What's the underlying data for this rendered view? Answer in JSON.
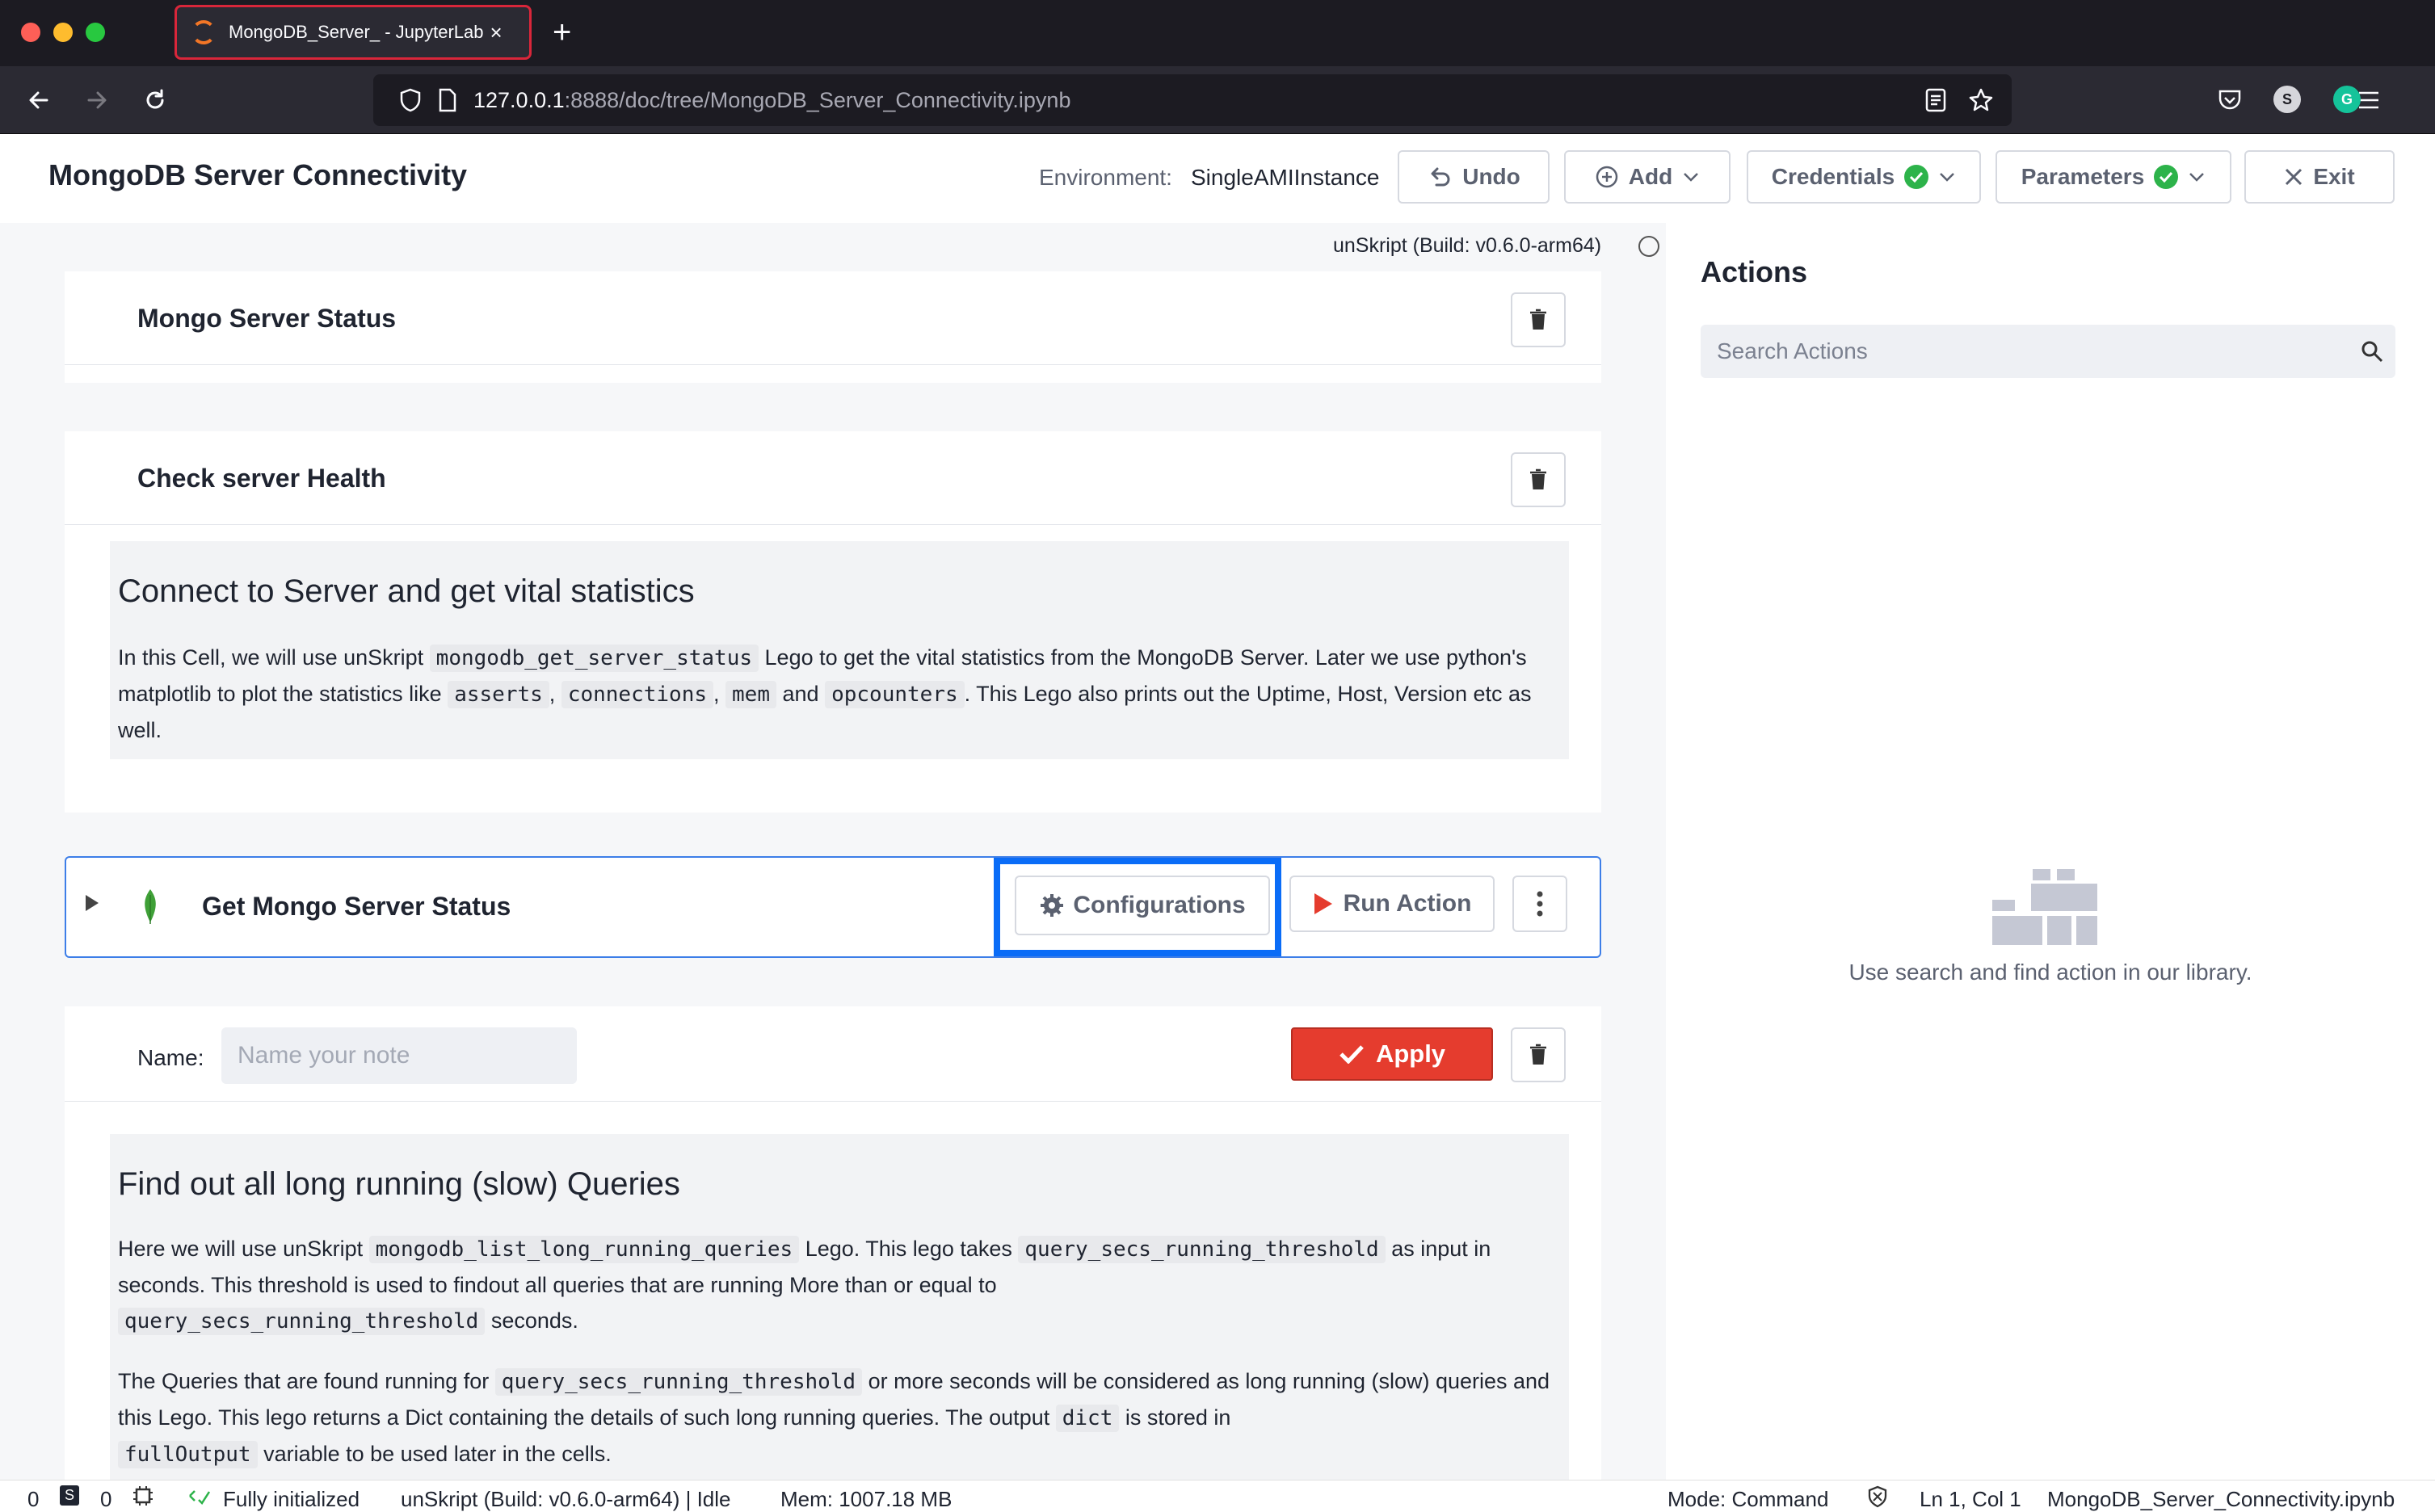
{
  "browser": {
    "tab_title": "MongoDB_Server_ - JupyterLab",
    "url_host": "127.0.0.1",
    "url_rest": ":8888/doc/tree/MongoDB_Server_Connectivity.ipynb"
  },
  "header": {
    "title": "MongoDB Server Connectivity",
    "environment_label": "Environment:",
    "environment_value": "SingleAMIInstance",
    "undo_label": "Undo",
    "add_label": "Add",
    "credentials_label": "Credentials",
    "parameters_label": "Parameters",
    "exit_label": "Exit"
  },
  "kernel": {
    "status": "unSkript (Build: v0.6.0-arm64)"
  },
  "cells": {
    "status_title": "Mongo Server Status",
    "health_title": "Check server Health",
    "md1": {
      "heading": "Connect to Server and get vital statistics",
      "p_1": "In this Cell, we will use unSkript",
      "code_1": "mongodb_get_server_status",
      "p_2": "Lego to get the vital statistics from the MongoDB Server. Later we use python's matplotlib to plot the statistics like",
      "code_2": "asserts",
      "sep_1": ",",
      "code_3": "connections",
      "sep_2": ",",
      "code_4": "mem",
      "p_3": "and",
      "code_5": "opcounters",
      "p_4": ". This Lego also prints out the Uptime, Host, Version etc as well."
    },
    "action": {
      "title": "Get Mongo Server Status",
      "configurations_label": "Configurations",
      "run_label": "Run Action"
    },
    "note": {
      "name_label": "Name:",
      "name_placeholder": "Name your note",
      "apply_label": "Apply"
    },
    "md2": {
      "heading": "Find out all long running (slow) Queries",
      "a_1": "Here we will use unSkript",
      "a_code_1": "mongodb_list_long_running_queries",
      "a_2": "Lego. This lego takes",
      "a_code_2": "query_secs_running_threshold",
      "a_3": "as input in seconds. This threshold is used to findout all queries that are running More than or equal to",
      "a_code_3": "query_secs_running_threshold",
      "a_4": "seconds.",
      "b_1": "The Queries that are found running for",
      "b_code_1": "query_secs_running_threshold",
      "b_2": "or more seconds will be considered as long running (slow) queries and this Lego. This lego returns a Dict containing the details of such long running queries. The output",
      "b_code_2": "dict",
      "b_3": "is stored in",
      "b_code_3": "fullOutput",
      "b_4": "variable to be used later in the cells."
    }
  },
  "panel": {
    "title": "Actions",
    "search_placeholder": "Search Actions",
    "empty_text": "Use search and find action in our library."
  },
  "statusbar": {
    "count_1": "0",
    "s_badge": "S",
    "count_2": "0",
    "init_text": "Fully initialized",
    "kernel_text": "unSkript (Build: v0.6.0-arm64) | Idle",
    "mem_text": "Mem: 1007.18 MB",
    "mode_text": "Mode: Command",
    "position_text": "Ln 1, Col 1",
    "file_text": "MongoDB_Server_Connectivity.ipynb"
  },
  "colors": {
    "accent_blue": "#0a6cf7",
    "apply_red": "#e53c2e",
    "check_green": "#2db34a"
  }
}
